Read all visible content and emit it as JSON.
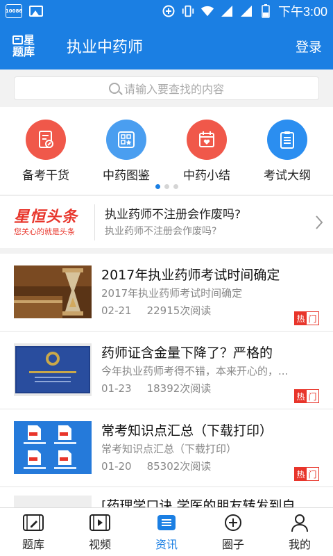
{
  "status_bar": {
    "carrier_badge": "10086",
    "time": "下午3:00"
  },
  "header": {
    "logo_line1": "星",
    "logo_line2": "题库",
    "title": "执业中药师",
    "login": "登录"
  },
  "search": {
    "placeholder": "请输入要查找的内容"
  },
  "categories": [
    {
      "label": "备考干货",
      "color": "#f0584a",
      "icon": "document-edit-icon"
    },
    {
      "label": "中药图鉴",
      "color": "#4a9ef0",
      "icon": "grid-star-icon"
    },
    {
      "label": "中药小结",
      "color": "#f0584a",
      "icon": "calendar-heart-icon"
    },
    {
      "label": "考试大纲",
      "color": "#2b8ef0",
      "icon": "clipboard-icon"
    }
  ],
  "headline": {
    "brand": "星恒头条",
    "slogan": "您关心的就是头条",
    "title": "执业药师不注册会作废吗?",
    "subtitle": "执业药师不注册会作废吗?"
  },
  "news": [
    {
      "title": "2017年执业药师考试时间确定",
      "desc": "2017年执业药师考试时间确定",
      "date": "02-21",
      "reads": "22915次阅读",
      "hot1": "热",
      "hot2": "门"
    },
    {
      "title": "药师证含金量下降了？严格的",
      "desc": "今年执业药师考得不错，本来开心的，...",
      "date": "01-23",
      "reads": "18392次阅读",
      "hot1": "热",
      "hot2": "门"
    },
    {
      "title": "常考知识点汇总（下载打印）",
      "desc": "常考知识点汇总（下载打印）",
      "date": "01-20",
      "reads": "85302次阅读",
      "hot1": "热",
      "hot2": "门"
    }
  ],
  "peek_title": "[药理学口诀 学医的朋友转发到自",
  "tabs": [
    {
      "label": "题库"
    },
    {
      "label": "视频"
    },
    {
      "label": "资讯"
    },
    {
      "label": "圈子"
    },
    {
      "label": "我的"
    }
  ],
  "colors": {
    "primary": "#1b7fe3",
    "hot_red": "#e8352b"
  }
}
